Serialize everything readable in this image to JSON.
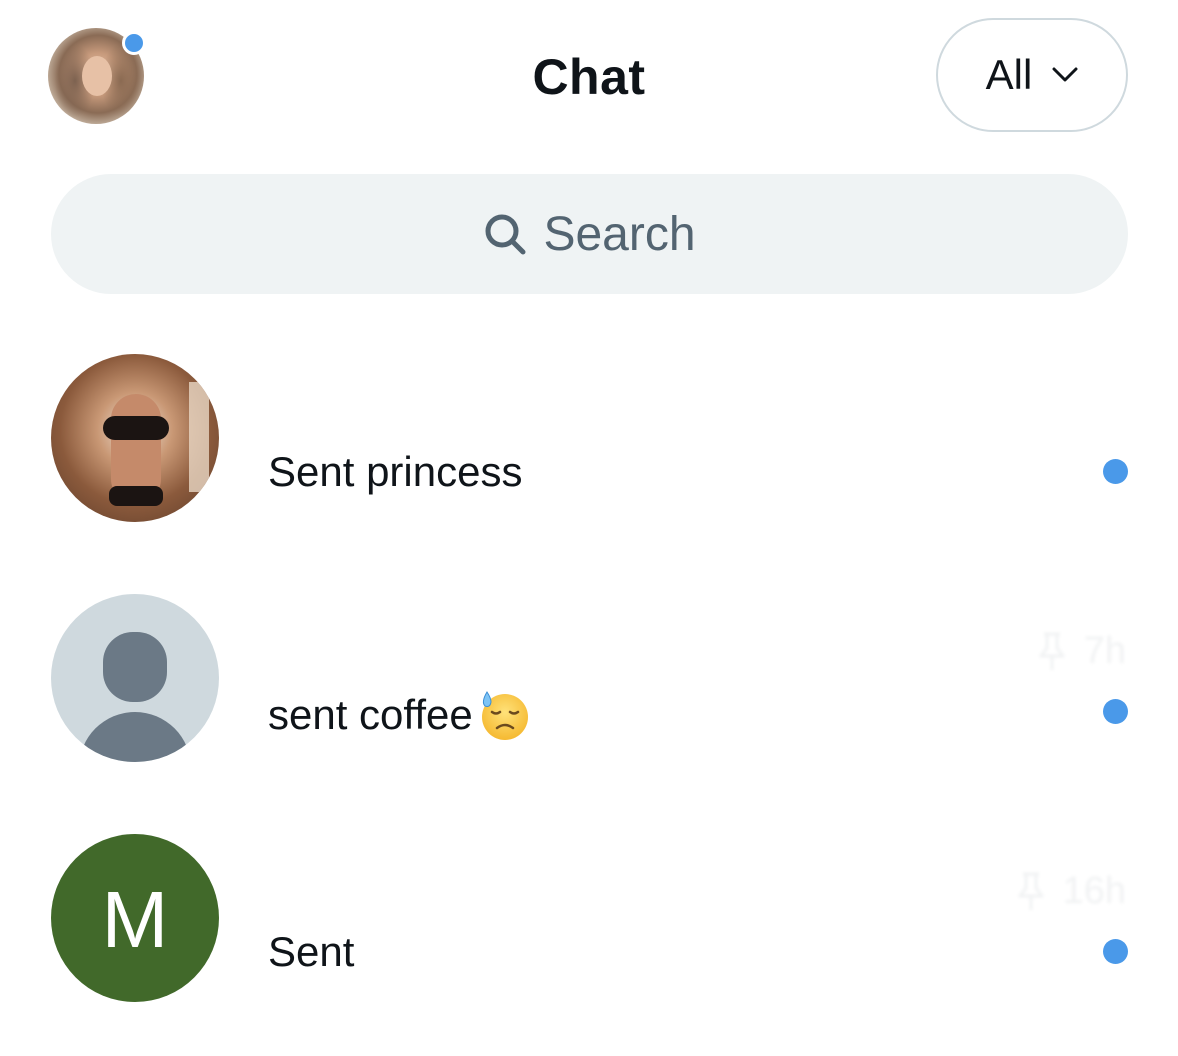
{
  "header": {
    "title": "Chat",
    "filter_label": "All",
    "profile_has_indicator": true
  },
  "search": {
    "placeholder": "Search"
  },
  "colors": {
    "accent": "#4a99e9",
    "text_primary": "#0f1419",
    "text_secondary": "#536471",
    "search_bg": "#eff3f4",
    "letter_avatar_bg": "#41692a"
  },
  "conversations": [
    {
      "name": "",
      "time": "",
      "pinned": false,
      "message": "Sent princess",
      "avatar": "photo",
      "unread": true
    },
    {
      "name": "",
      "time": "7h",
      "pinned": true,
      "message": "sent coffee",
      "emoji": "downcast-face-with-sweat",
      "avatar": "default-person-icon",
      "unread": true
    },
    {
      "name": "",
      "time": "16h",
      "pinned": true,
      "message": "Sent",
      "avatar_letter": "M",
      "avatar": "letter",
      "unread": true
    }
  ]
}
